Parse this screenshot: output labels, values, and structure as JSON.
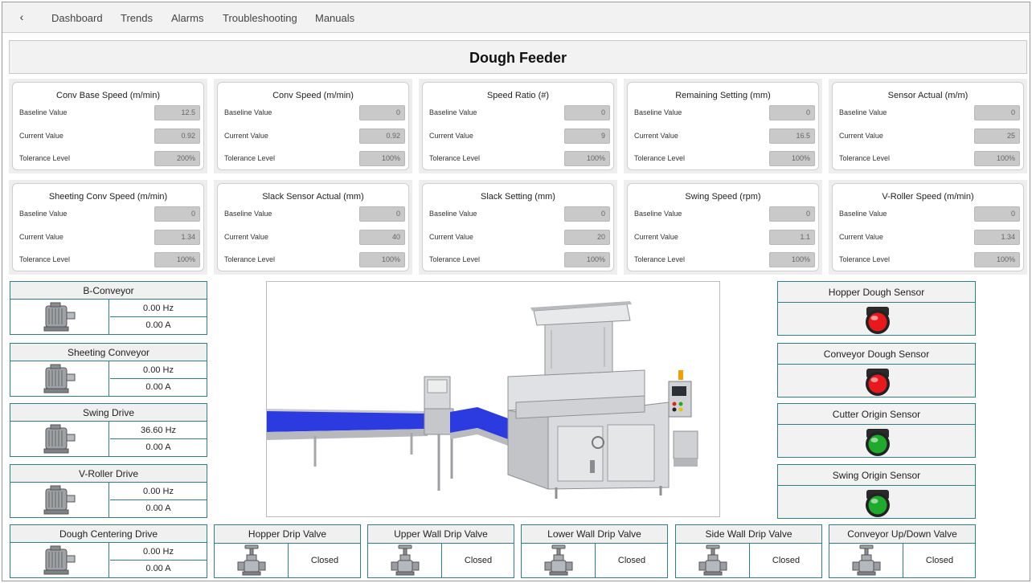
{
  "nav": {
    "back_icon": "chevron-left-icon",
    "items": [
      "Dashboard",
      "Trends",
      "Alarms",
      "Troubleshooting",
      "Manuals"
    ]
  },
  "title": "Dough Feeder",
  "row_labels": [
    "Baseline Value",
    "Current Value",
    "Tolerance Level"
  ],
  "cards": [
    {
      "title": "Conv Base Speed (m/min)",
      "baseline": "12.5",
      "current": "0.92",
      "tolerance": "200%"
    },
    {
      "title": "Conv Speed (m/min)",
      "baseline": "0",
      "current": "0.92",
      "tolerance": "100%"
    },
    {
      "title": "Speed Ratio (#)",
      "baseline": "0",
      "current": "9",
      "tolerance": "100%"
    },
    {
      "title": "Remaining Setting (mm)",
      "baseline": "0",
      "current": "16.5",
      "tolerance": "100%"
    },
    {
      "title": "Sensor Actual (m/m)",
      "baseline": "0",
      "current": "25",
      "tolerance": "100%"
    },
    {
      "title": "Sheeting Conv Speed (m/min)",
      "baseline": "0",
      "current": "1.34",
      "tolerance": "100%"
    },
    {
      "title": "Slack Sensor Actual (mm)",
      "baseline": "0",
      "current": "40",
      "tolerance": "100%"
    },
    {
      "title": "Slack Setting (mm)",
      "baseline": "0",
      "current": "20",
      "tolerance": "100%"
    },
    {
      "title": "Swing Speed (rpm)",
      "baseline": "0",
      "current": "1.1",
      "tolerance": "100%"
    },
    {
      "title": "V-Roller Speed (m/min)",
      "baseline": "0",
      "current": "1.34",
      "tolerance": "100%"
    }
  ],
  "drives": [
    {
      "name": "B-Conveyor",
      "hz": "0.00 Hz",
      "amps": "0.00 A",
      "icon": "motor-icon"
    },
    {
      "name": "Sheeting Conveyor",
      "hz": "0.00 Hz",
      "amps": "0.00 A",
      "icon": "motor-icon"
    },
    {
      "name": "Swing Drive",
      "hz": "36.60 Hz",
      "amps": "0.00 A",
      "icon": "motor-icon"
    },
    {
      "name": "V-Roller Drive",
      "hz": "0.00 Hz",
      "amps": "0.00 A",
      "icon": "motor-icon"
    },
    {
      "name": "Dough Centering Drive",
      "hz": "0.00 Hz",
      "amps": "0.00 A",
      "icon": "motor-icon"
    }
  ],
  "sensors": [
    {
      "name": "Hopper Dough Sensor",
      "status": "red",
      "color": "#e8191c"
    },
    {
      "name": "Conveyor Dough Sensor",
      "status": "red",
      "color": "#e8191c"
    },
    {
      "name": "Cutter Origin Sensor",
      "status": "green",
      "color": "#1faa2c"
    },
    {
      "name": "Swing Origin Sensor",
      "status": "green",
      "color": "#1faa2c"
    }
  ],
  "valves": [
    {
      "name": "Hopper Drip Valve",
      "state": "Closed",
      "icon": "valve-icon"
    },
    {
      "name": "Upper Wall Drip Valve",
      "state": "Closed",
      "icon": "valve-icon"
    },
    {
      "name": "Lower Wall Drip Valve",
      "state": "Closed",
      "icon": "valve-icon"
    },
    {
      "name": "Side Wall Drip Valve",
      "state": "Closed",
      "icon": "valve-icon"
    },
    {
      "name": "Conveyor Up/Down Valve",
      "state": "Closed",
      "icon": "valve-icon"
    }
  ],
  "colors": {
    "panel_border": "#2e7f86",
    "conveyor_belt": "#2b3be0"
  },
  "machine_image": "dough-feeder-machine-illustration"
}
